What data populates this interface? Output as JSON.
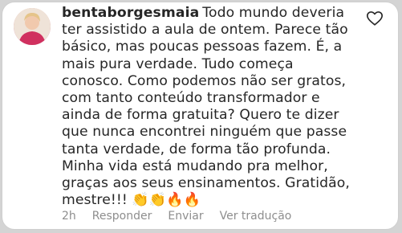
{
  "comment": {
    "username": "bentaborgesmaia",
    "text": "Todo mundo deveria ter assistido a aula de ontem. Parece tão básico, mas poucas pessoas fazem. É, a mais pura verdade. Tudo começa conosco. Como podemos não ser gratos, com tanto conteúdo transformador e ainda de forma gratuita? Quero te dizer que nunca encontrei ninguém que passe tanta verdade, de forma tão profunda. Minha vida está mudando pra melhor, graças aos seus ensinamentos. Gratidão, mestre!!! 👏👏🔥🔥"
  },
  "meta": {
    "time": "2h",
    "reply": "Responder",
    "send": "Enviar",
    "translation": "Ver tradução"
  },
  "icons": {
    "like": "heart-outline-icon",
    "avatar": "profile-avatar"
  }
}
